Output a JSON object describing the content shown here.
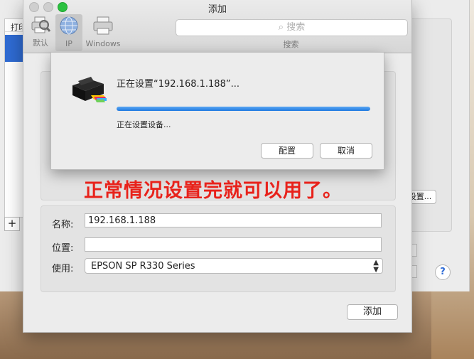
{
  "background_window": {
    "list_header": "打印",
    "options_button": "设置...",
    "add_symbol": "+",
    "help_symbol": "?"
  },
  "add_window": {
    "title": "添加",
    "toolbar": [
      {
        "label": "默认",
        "icon": "default-printer-icon"
      },
      {
        "label": "IP",
        "icon": "ip-globe-icon",
        "selected": true
      },
      {
        "label": "Windows",
        "icon": "windows-printer-icon"
      }
    ],
    "search": {
      "placeholder": "搜索",
      "caption": "搜索"
    },
    "fields": {
      "name_label": "名称:",
      "name_value": "192.168.1.188",
      "location_label": "位置:",
      "location_value": "",
      "use_label": "使用:",
      "use_value": "EPSON SP R330 Series"
    },
    "add_button": "添加"
  },
  "sheet": {
    "title": "正在设置“192.168.1.188”...",
    "status": "正在设置设备...",
    "progress_fraction": 1.0,
    "configure_button": "配置",
    "cancel_button": "取消"
  },
  "annotation": {
    "text": "正常情况设置完就可以用了。",
    "color": "#e8221b"
  }
}
